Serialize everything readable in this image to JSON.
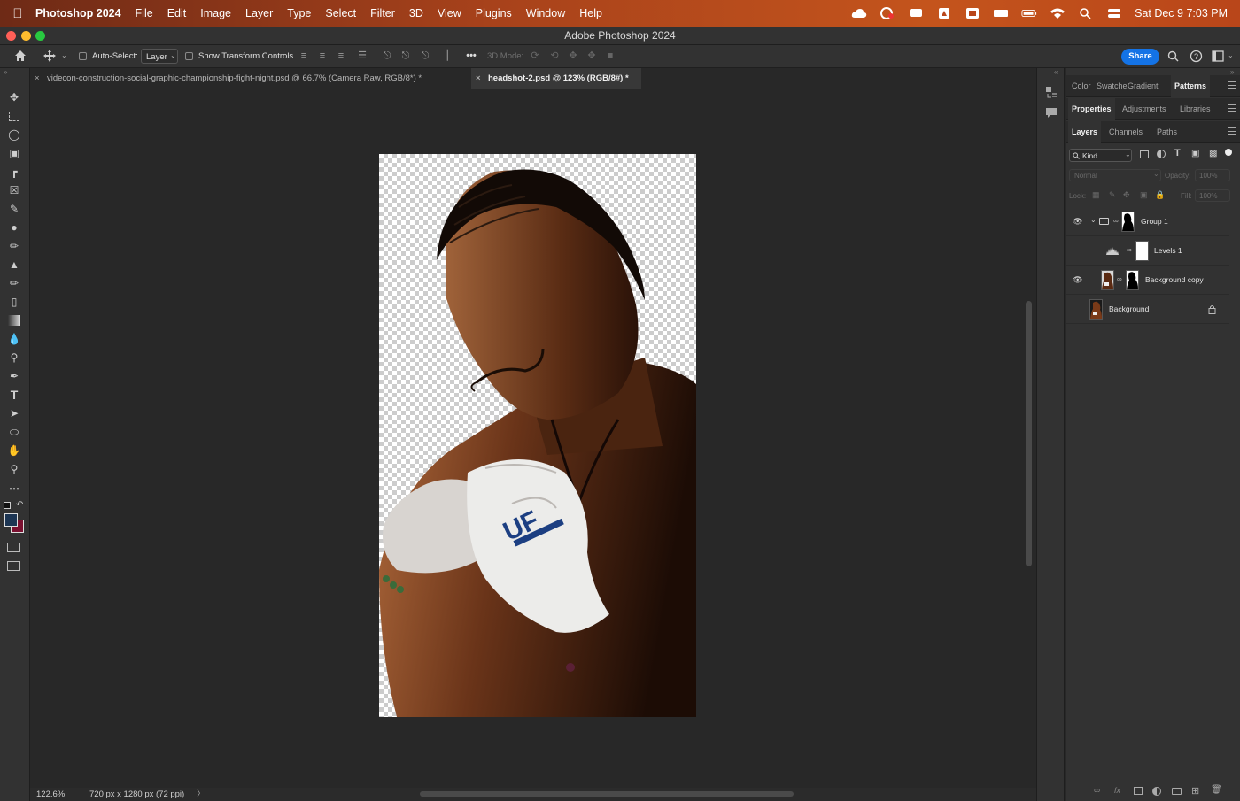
{
  "menubar": {
    "app_name": "Photoshop 2024",
    "items": [
      "File",
      "Edit",
      "Image",
      "Layer",
      "Type",
      "Select",
      "Filter",
      "3D",
      "View",
      "Plugins",
      "Window",
      "Help"
    ],
    "datetime": "Sat Dec 9  7:03 PM"
  },
  "window": {
    "title": "Adobe Photoshop 2024"
  },
  "options": {
    "auto_select_label": "Auto-Select:",
    "auto_select_value": "Layer",
    "transform_label": "Show Transform Controls",
    "mode_3d_label": "3D Mode:",
    "share_label": "Share"
  },
  "tabs": [
    {
      "label": "videcon-construction-social-graphic-championship-fight-night.psd @ 66.7% (Camera Raw, RGB/8*) *",
      "active": false
    },
    {
      "label": "headshot-2.psd @ 123% (RGB/8#) *",
      "active": true
    }
  ],
  "status": {
    "zoom": "122.6%",
    "doc_info": "720 px x 1280 px (72 ppi)",
    "arrow": "〉"
  },
  "panels": {
    "row1": [
      "Color",
      "Swatche",
      "Gradient",
      "Patterns"
    ],
    "row2": [
      "Properties",
      "Adjustments",
      "Libraries"
    ],
    "row3": [
      "Layers",
      "Channels",
      "Paths"
    ],
    "filter_kind": "Kind",
    "blend_mode": "Normal",
    "opacity_label": "Opacity:",
    "opacity_value": "100%",
    "lock_label": "Lock:",
    "fill_label": "Fill:",
    "fill_value": "100%",
    "layers": [
      {
        "name": "Group 1",
        "visible": true
      },
      {
        "name": "Levels 1",
        "visible": false
      },
      {
        "name": "Background copy",
        "visible": true
      },
      {
        "name": "Background",
        "visible": false
      }
    ]
  },
  "colors": {
    "foreground": "#1c3553",
    "background": "#7a1030",
    "accent": "#1473e6"
  }
}
